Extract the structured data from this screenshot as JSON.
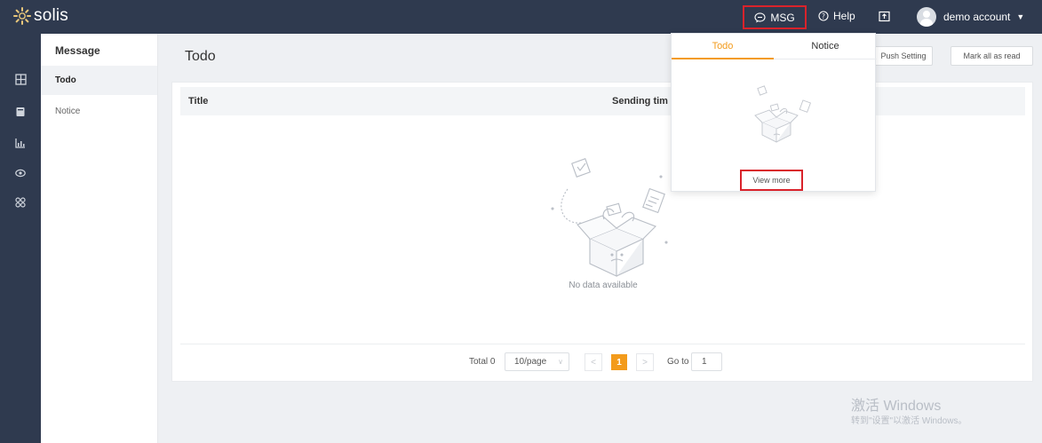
{
  "app": {
    "logo_text": "solis"
  },
  "topbar": {
    "msg_label": "MSG",
    "help_label": "Help",
    "account_label": "demo account",
    "account_caret": "▼"
  },
  "rail": {
    "icons": [
      "dashboard-icon",
      "device-icon",
      "report-icon",
      "view-icon",
      "apps-icon"
    ]
  },
  "sidebar": {
    "title": "Message",
    "items": [
      {
        "label": "Todo",
        "active": true
      },
      {
        "label": "Notice",
        "active": false
      }
    ]
  },
  "page": {
    "title": "Todo",
    "push_setting_label": "Push Setting",
    "mark_all_read_label": "Mark all as read"
  },
  "table": {
    "columns": [
      "Title",
      "Sending tim"
    ],
    "empty_text": "No data available"
  },
  "pagination": {
    "total_text": "Total 0",
    "page_size": "10/page",
    "prev": "<",
    "current_page": "1",
    "next": ">",
    "goto_label": "Go to",
    "goto_value": "1"
  },
  "popover": {
    "tabs": [
      {
        "label": "Todo",
        "active": true
      },
      {
        "label": "Notice",
        "active": false
      }
    ],
    "view_more_label": "View more"
  },
  "watermark": {
    "line1": "激活 Windows",
    "line2": "转到\"设置\"以激活 Windows。"
  },
  "colors": {
    "topbar_bg": "#2f3a4f",
    "accent": "#f39b1c",
    "highlight_border": "#d9232b",
    "page_bg": "#eef0f3"
  }
}
